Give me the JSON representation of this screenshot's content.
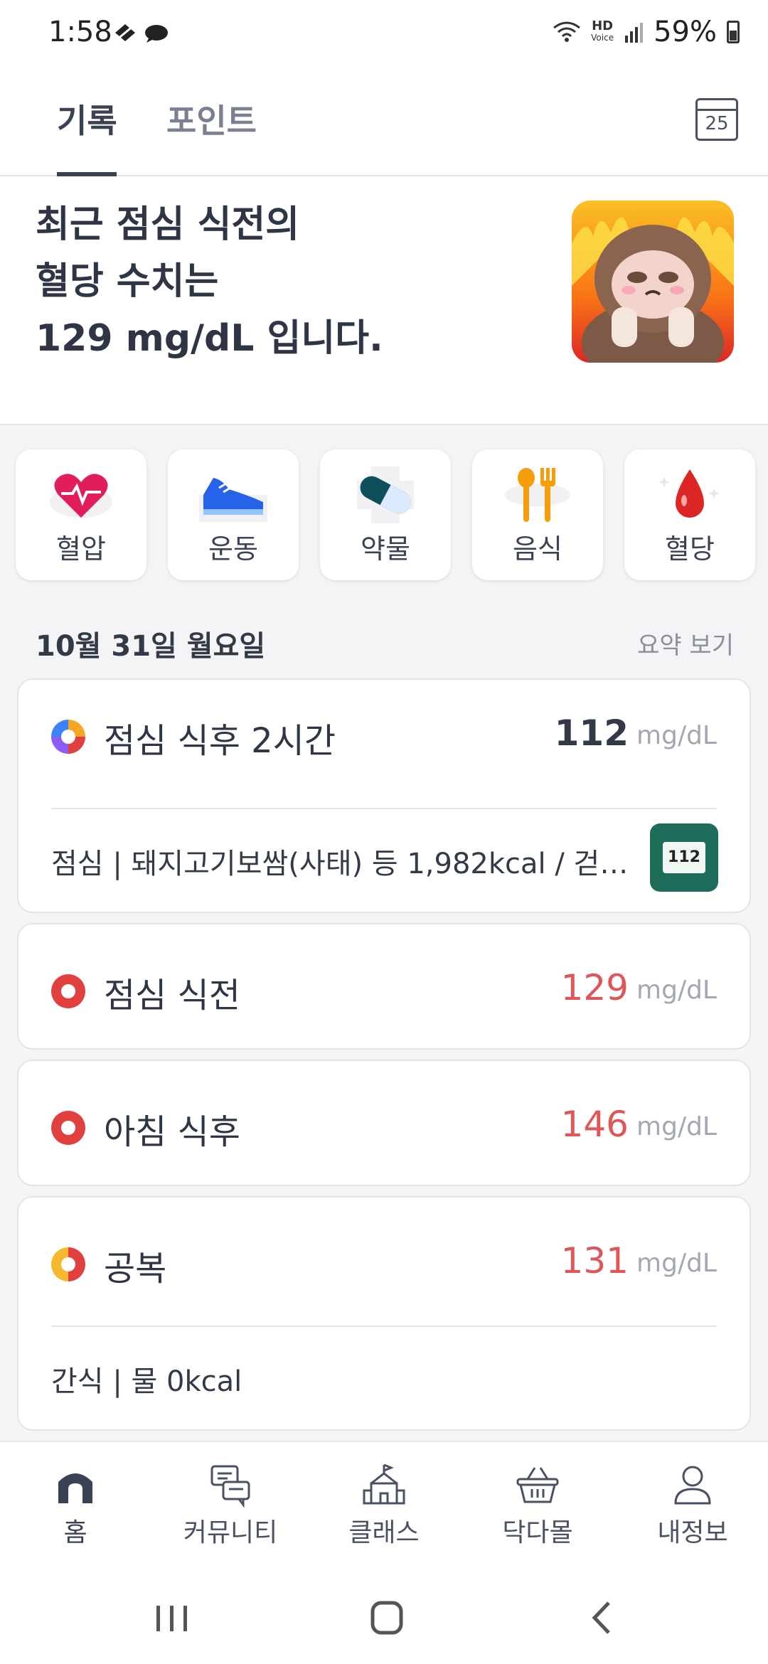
{
  "status_bar": {
    "time": "1:58",
    "hd_label": "HD",
    "voice_label": "Voice",
    "battery": "59%"
  },
  "tabs": [
    {
      "label": "기록",
      "active": true
    },
    {
      "label": "포인트",
      "active": false
    }
  ],
  "calendar": {
    "day": "25",
    "icon": "calendar-icon"
  },
  "hero": {
    "line1": "최근 점심 식전의",
    "line2": "혈당 수치는",
    "line3": "129 mg/dL 입니다."
  },
  "categories": [
    {
      "label": "혈압",
      "icon": "heart-pulse-icon"
    },
    {
      "label": "운동",
      "icon": "sneaker-icon"
    },
    {
      "label": "약물",
      "icon": "pill-icon"
    },
    {
      "label": "음식",
      "icon": "spoon-fork-icon"
    },
    {
      "label": "혈당",
      "icon": "blood-drop-icon"
    }
  ],
  "date_header": {
    "date": "10월 31일 월요일",
    "summary_link": "요약 보기"
  },
  "records": [
    {
      "title": "점심 식후 2시간",
      "value": "112",
      "unit": "mg/dL",
      "sub": "점심 | 돼지고기보쌈(사태) 등 1,982kcal / 걷…",
      "device_reading": "112"
    },
    {
      "title": "점심 식전",
      "value": "129",
      "unit": "mg/dL"
    },
    {
      "title": "아침 식후",
      "value": "146",
      "unit": "mg/dL"
    },
    {
      "title": "공복",
      "value": "131",
      "unit": "mg/dL",
      "sub": "간식 | 물 0kcal"
    }
  ],
  "colors": {
    "accent": "#3a4254",
    "high_value": "#e05555",
    "background": "#f4f4f6"
  },
  "bottom_nav": [
    {
      "label": "홈",
      "icon": "home-icon"
    },
    {
      "label": "커뮤니티",
      "icon": "chat-icon"
    },
    {
      "label": "클래스",
      "icon": "school-icon"
    },
    {
      "label": "닥다몰",
      "icon": "basket-icon"
    },
    {
      "label": "내정보",
      "icon": "person-icon"
    }
  ]
}
